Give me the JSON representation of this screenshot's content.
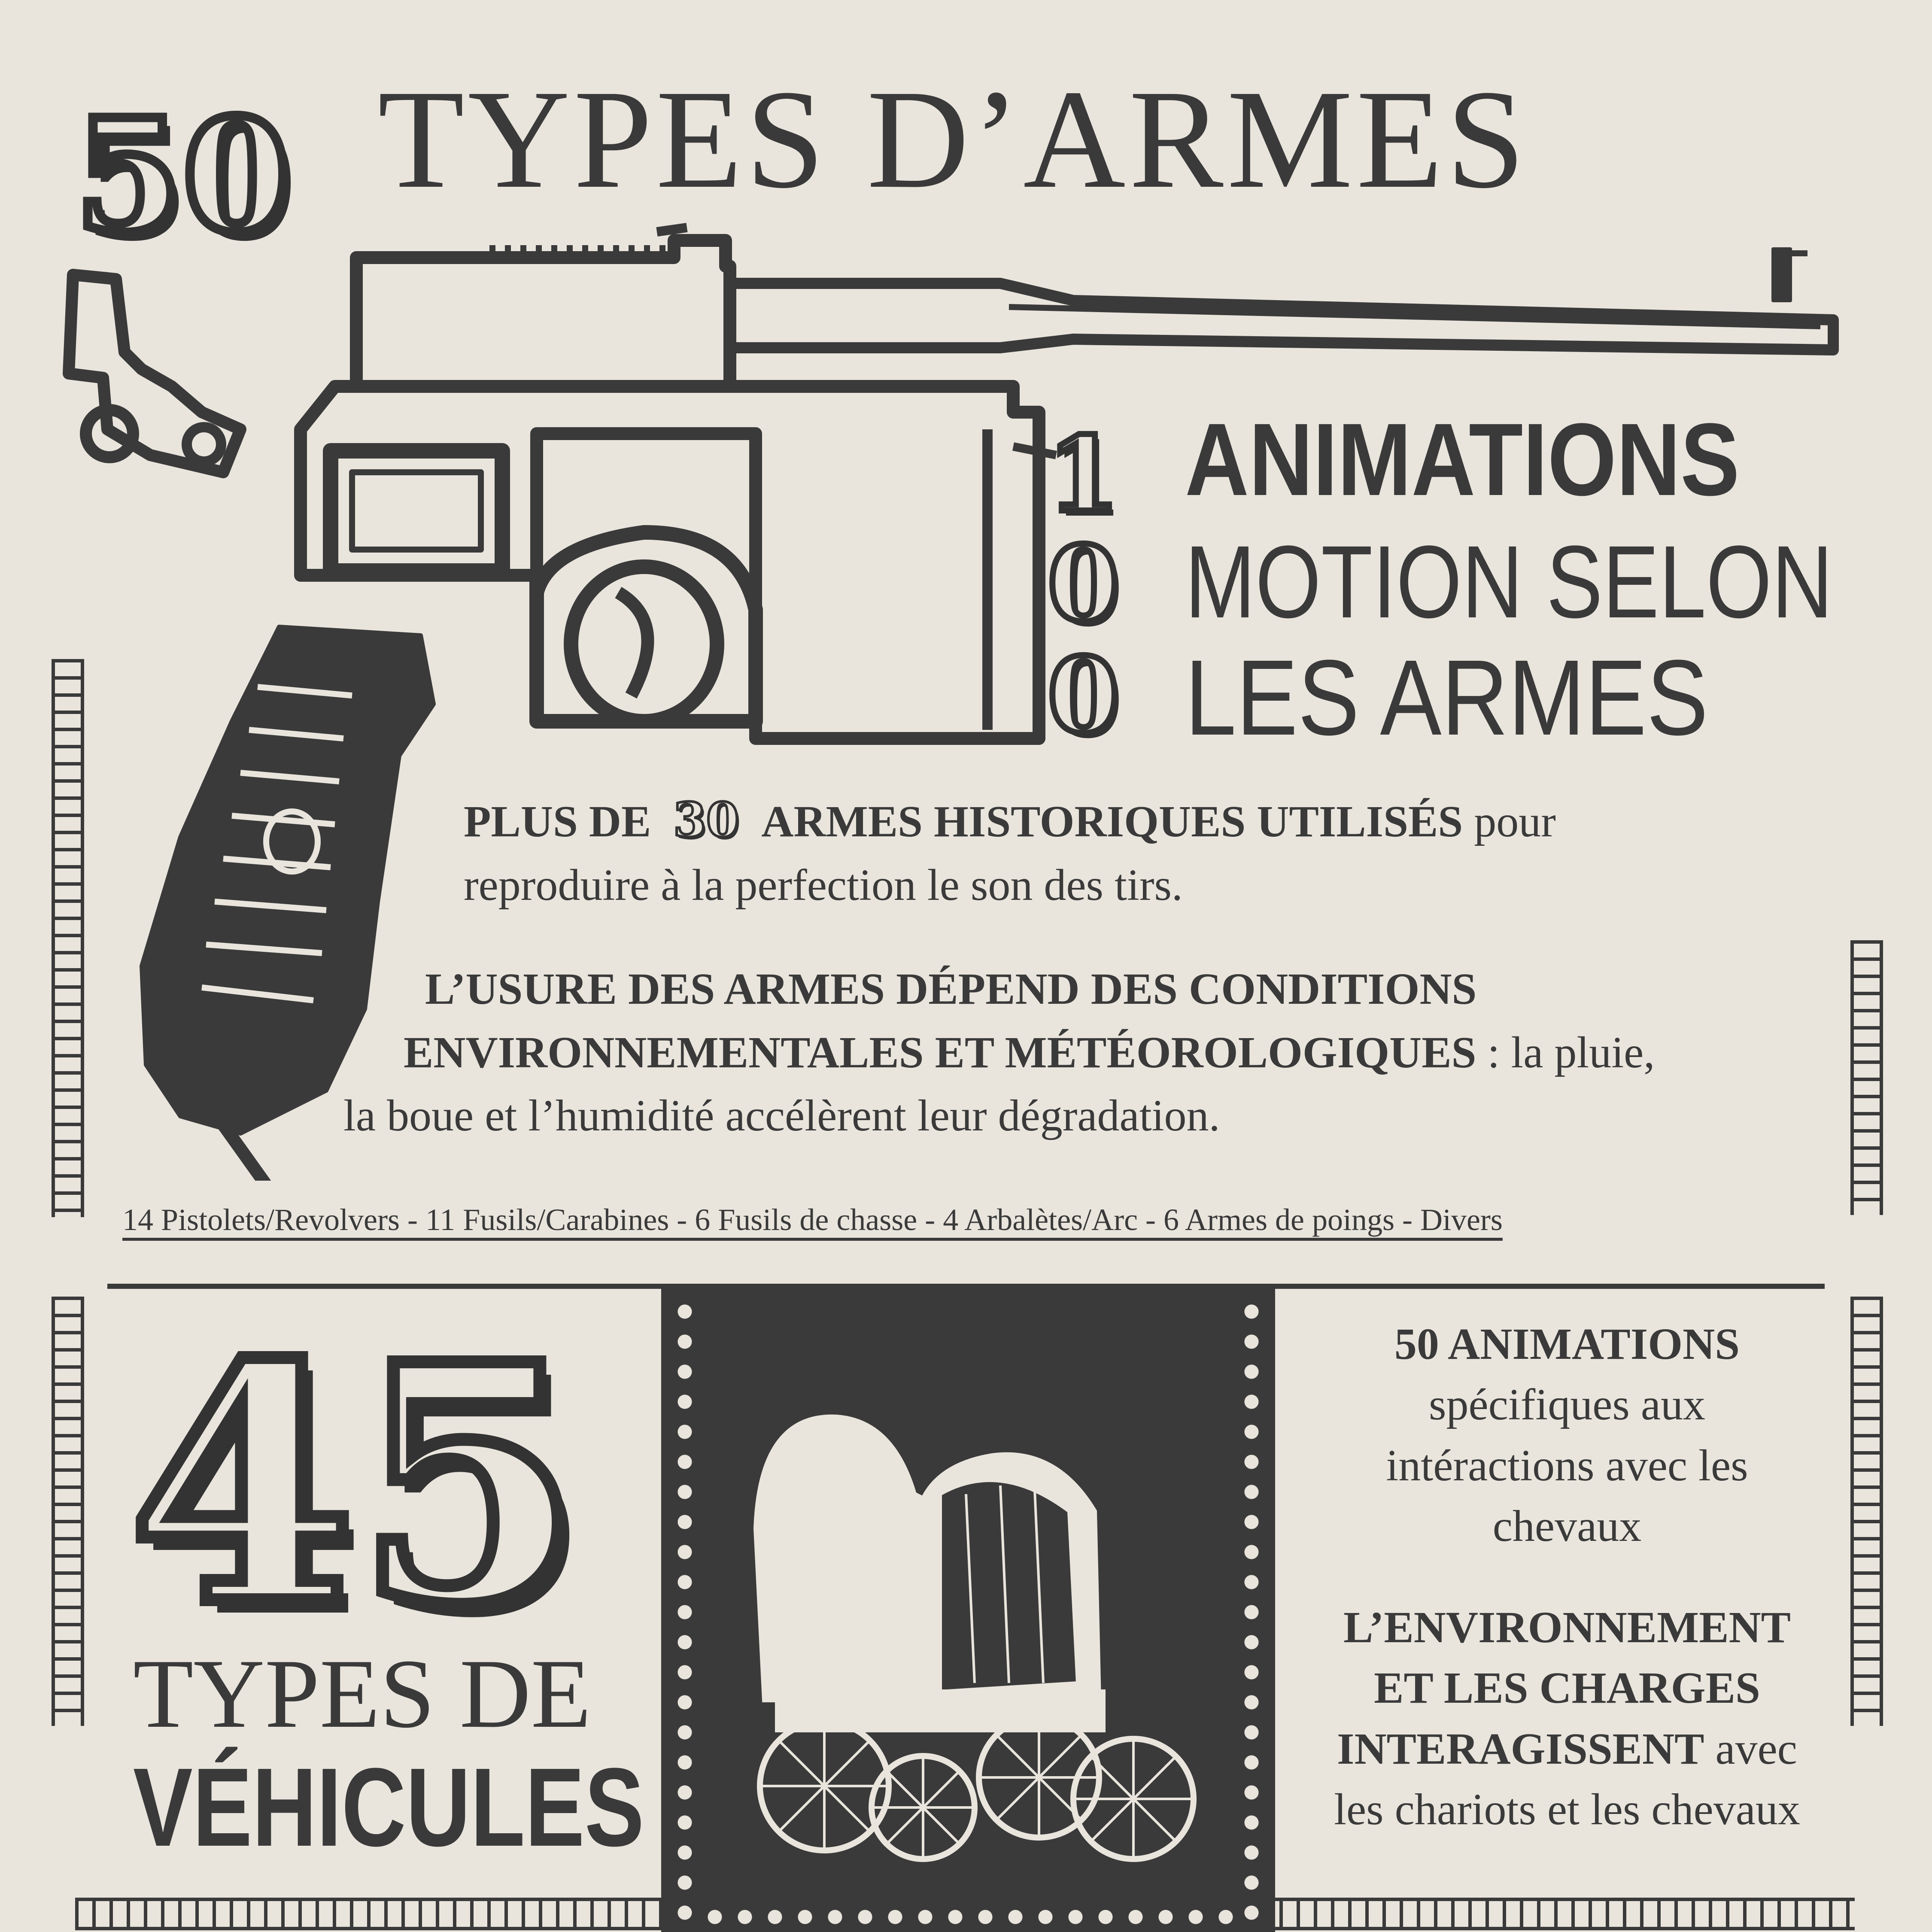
{
  "header": {
    "count": "50",
    "title": "TYPES D’ARMES"
  },
  "animations": {
    "counter_digits": [
      "1",
      "0",
      "0"
    ],
    "lines": [
      "ANIMATIONS",
      "MOTION SELON",
      "LES ARMES"
    ]
  },
  "weapons_section": {
    "p1_bold_a": "PLUS DE",
    "p1_number": "30",
    "p1_bold_b": "ARMES HISTORIQUES UTILISÉS",
    "p1_rest_line1": "pour",
    "p1_line2": "reproduire à la perfection le son des tirs.",
    "p2_bold_line1": "L’USURE DES ARMES DÉPEND DES CONDITIONS",
    "p2_bold_line2": "ENVIRONNEMENTALES ET MÉTÉOROLOGIQUES",
    "p2_rest_line2": ": la pluie,",
    "p2_line3": "la boue et l’humidité accélèrent leur dégradation.",
    "categories": "14 Pistolets/Revolvers - 11 Fusils/Carabines - 6 Fusils de chasse - 4 Arbalètes/Arc - 6 Armes de poings - Divers"
  },
  "vehicles_section": {
    "count": "45",
    "title_line1": "TYPES DE",
    "title_line2": "VÉHICULES",
    "r1_bold": "50 ANIMATIONS",
    "r1_lines": [
      "spécifiques aux",
      "intéractions avec les",
      "chevaux"
    ],
    "r2_bold_lines": [
      "L’ENVIRONNEMENT",
      "ET LES CHARGES",
      "INTERAGISSENT"
    ],
    "r2_rest": "avec",
    "r2_last": "les chariots et les chevaux"
  },
  "colors": {
    "ink": "#3a3a3a",
    "paper": "#e9e5dd"
  },
  "icons": [
    "mauser-pistol-illustration",
    "covered-wagon-illustration"
  ]
}
